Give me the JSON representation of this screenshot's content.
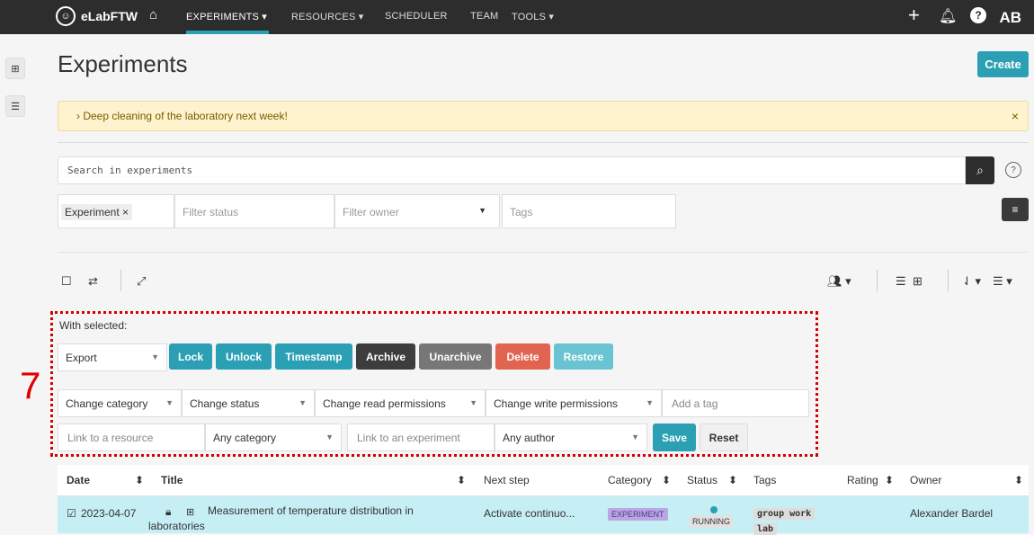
{
  "nav": {
    "brand": "eLabFTW",
    "items": [
      "EXPERIMENTS ▾",
      "RESOURCES ▾",
      "SCHEDULER",
      "TEAM",
      "TOOLS ▾"
    ],
    "avatar": "AB"
  },
  "page": {
    "title": "Experiments",
    "create_label": "Create"
  },
  "alert": {
    "text": "Deep cleaning of the laboratory next week!"
  },
  "search": {
    "placeholder": "Search in experiments"
  },
  "filters": {
    "chip": "Experiment ×",
    "status": "Filter status",
    "owner": "Filter owner",
    "tags": "Tags"
  },
  "annotation_number": "7",
  "with_selected": {
    "label": "With selected:",
    "export": "Export",
    "buttons": {
      "lock": "Lock",
      "unlock": "Unlock",
      "timestamp": "Timestamp",
      "archive": "Archive",
      "unarchive": "Unarchive",
      "delete": "Delete",
      "restore": "Restore"
    },
    "change_category": "Change category",
    "change_status": "Change status",
    "change_read": "Change read permissions",
    "change_write": "Change write permissions",
    "add_tag": "Add a tag",
    "link_resource": "Link to a resource",
    "any_category": "Any category",
    "link_experiment": "Link to an experiment",
    "any_author": "Any author",
    "save": "Save",
    "reset": "Reset"
  },
  "table": {
    "headers": [
      "Date",
      "Title",
      "Next step",
      "Category",
      "Status",
      "Tags",
      "Rating",
      "Owner"
    ],
    "rows": [
      {
        "date": "2023-04-07",
        "title_line1": "Measurement of temperature distribution in",
        "title_line2": "laboratories",
        "next_step": "Activate continuo...",
        "category": "EXPERIMENT",
        "status": "RUNNING",
        "tag1": "group work",
        "tag2": "lab",
        "owner": "Alexander Bardel"
      }
    ]
  },
  "colors": {
    "teal": "#2ba0b5",
    "dark": "#2d2d2d",
    "archive": "#3d3d3d",
    "unarchive": "#777777",
    "delete": "#e0644f",
    "restore": "#69c3d2",
    "highlight": "#d40000"
  }
}
